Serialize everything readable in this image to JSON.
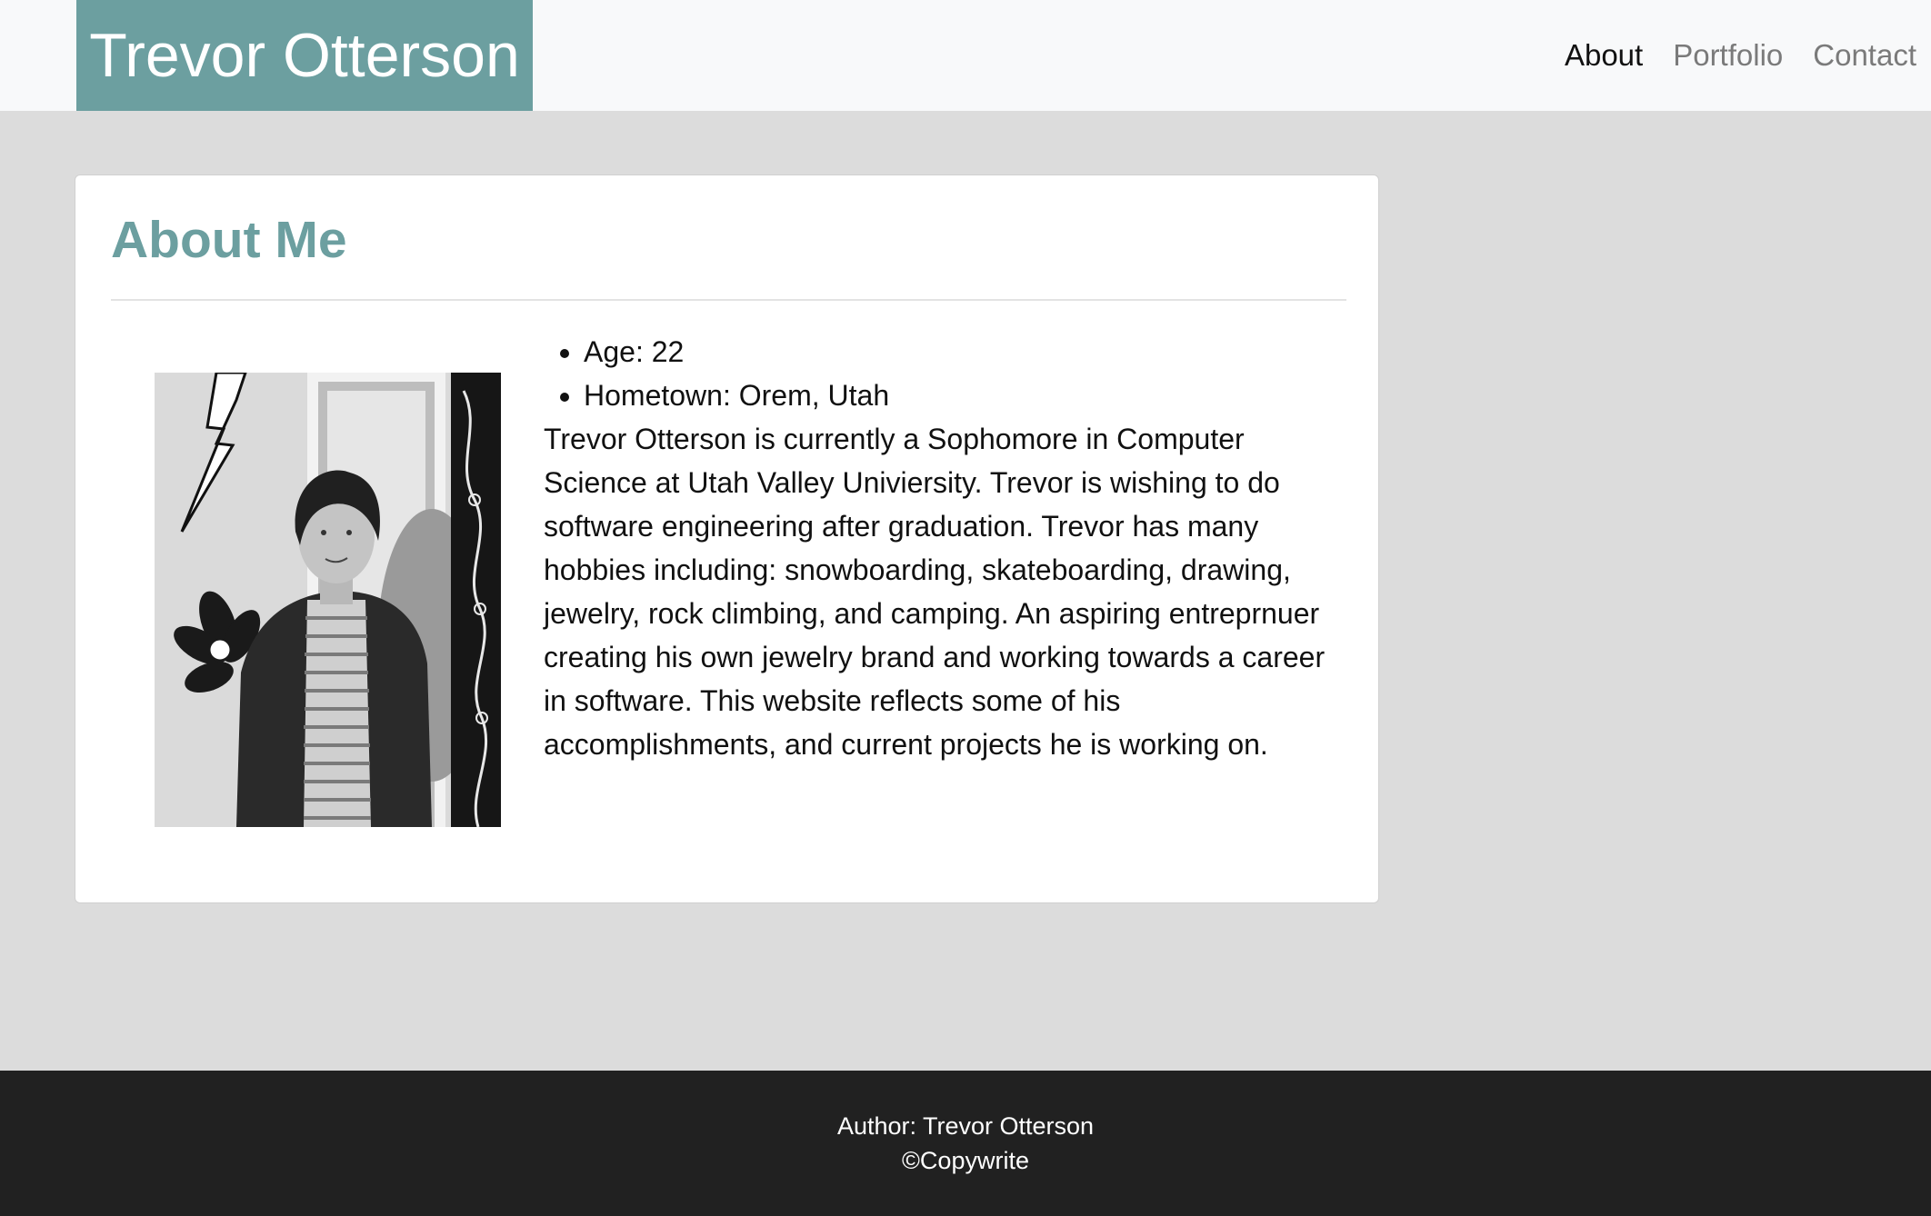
{
  "header": {
    "brand": "Trevor Otterson",
    "nav": [
      {
        "label": "About",
        "active": true
      },
      {
        "label": "Portfolio",
        "active": false
      },
      {
        "label": "Contact",
        "active": false
      }
    ]
  },
  "about": {
    "title": "About Me",
    "facts": [
      "Age: 22",
      "Hometown: Orem, Utah"
    ],
    "bio": "Trevor Otterson is currently a Sophomore in Computer Science at Utah Valley Univiersity. Trevor is wishing to do software engineering after graduation. Trevor has many hobbies including: snowboarding, skateboarding, drawing, jewelry, rock climbing, and camping. An aspiring entreprnuer creating his own jewelry brand and working towards a career in software. This website reflects some of his accomplishments, and current projects he is working on."
  },
  "footer": {
    "author": "Author: Trevor Otterson",
    "copyright": "©Copywrite"
  },
  "colors": {
    "accent": "#6c9fa0",
    "header_bg": "#f8f9fa",
    "page_bg": "#dcdcdc",
    "footer_bg": "#212121"
  }
}
